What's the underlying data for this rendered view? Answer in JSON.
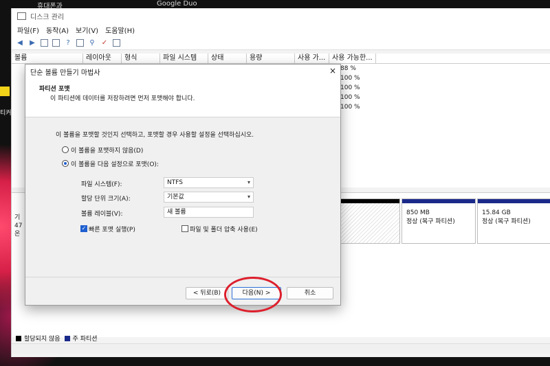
{
  "desktop": {
    "top_labels": [
      "휴대폰과",
      "Google Duo"
    ],
    "side_icon_text": "티커"
  },
  "window": {
    "title": "디스크 관리",
    "menu": [
      "파일(F)",
      "동작(A)",
      "보기(V)",
      "도움말(H)"
    ],
    "columns": [
      "볼륨",
      "레이아웃",
      "형식",
      "파일 시스템",
      "상태",
      "용량",
      "사용 가...",
      "사용 가능한..."
    ],
    "percent_rows": [
      "88 %",
      "100 %",
      "100 %",
      "100 %",
      "100 %"
    ],
    "disk_label": [
      "기",
      "47",
      "온"
    ],
    "partitions": [
      {
        "size": "850 MB",
        "status": "정상 (복구 파티션)"
      },
      {
        "size": "15.84 GB",
        "status": "정상 (복구 파티션)"
      }
    ],
    "legend": [
      {
        "label": "할당되지 않음",
        "color": "#000000"
      },
      {
        "label": "주 파티션",
        "color": "#1a2a8a"
      }
    ]
  },
  "dialog": {
    "title": "단순 볼륨 만들기 마법사",
    "close_icon": "×",
    "header_title": "파티션 포맷",
    "header_subtitle": "이 파티션에 데이터를 저장하려면 먼저 포맷해야 합니다.",
    "instruction": "이 볼륨을 포맷할 것인지 선택하고, 포맷할 경우 사용할 설정을 선택하십시오.",
    "radio_no_format": "이 볼륨을 포맷하지 않음(D)",
    "radio_format": "이 볼륨을 다음 설정으로 포맷(O):",
    "fs_label": "파일 시스템(F):",
    "fs_value": "NTFS",
    "alloc_label": "할당 단위 크기(A):",
    "alloc_value": "기본값",
    "vol_label": "볼륨 레이블(V):",
    "vol_value": "새 볼륨",
    "quick_format": "빠른 포맷 실행(P)",
    "compress": "파일 및 폴더 압축 사용(E)",
    "back": "< 뒤로(B)",
    "next": "다음(N) >",
    "cancel": "취소"
  },
  "colors": {
    "accent": "#1f5fd0",
    "partition_bar": "#1a2a8a",
    "highlight_circle": "#dd1f2c"
  }
}
